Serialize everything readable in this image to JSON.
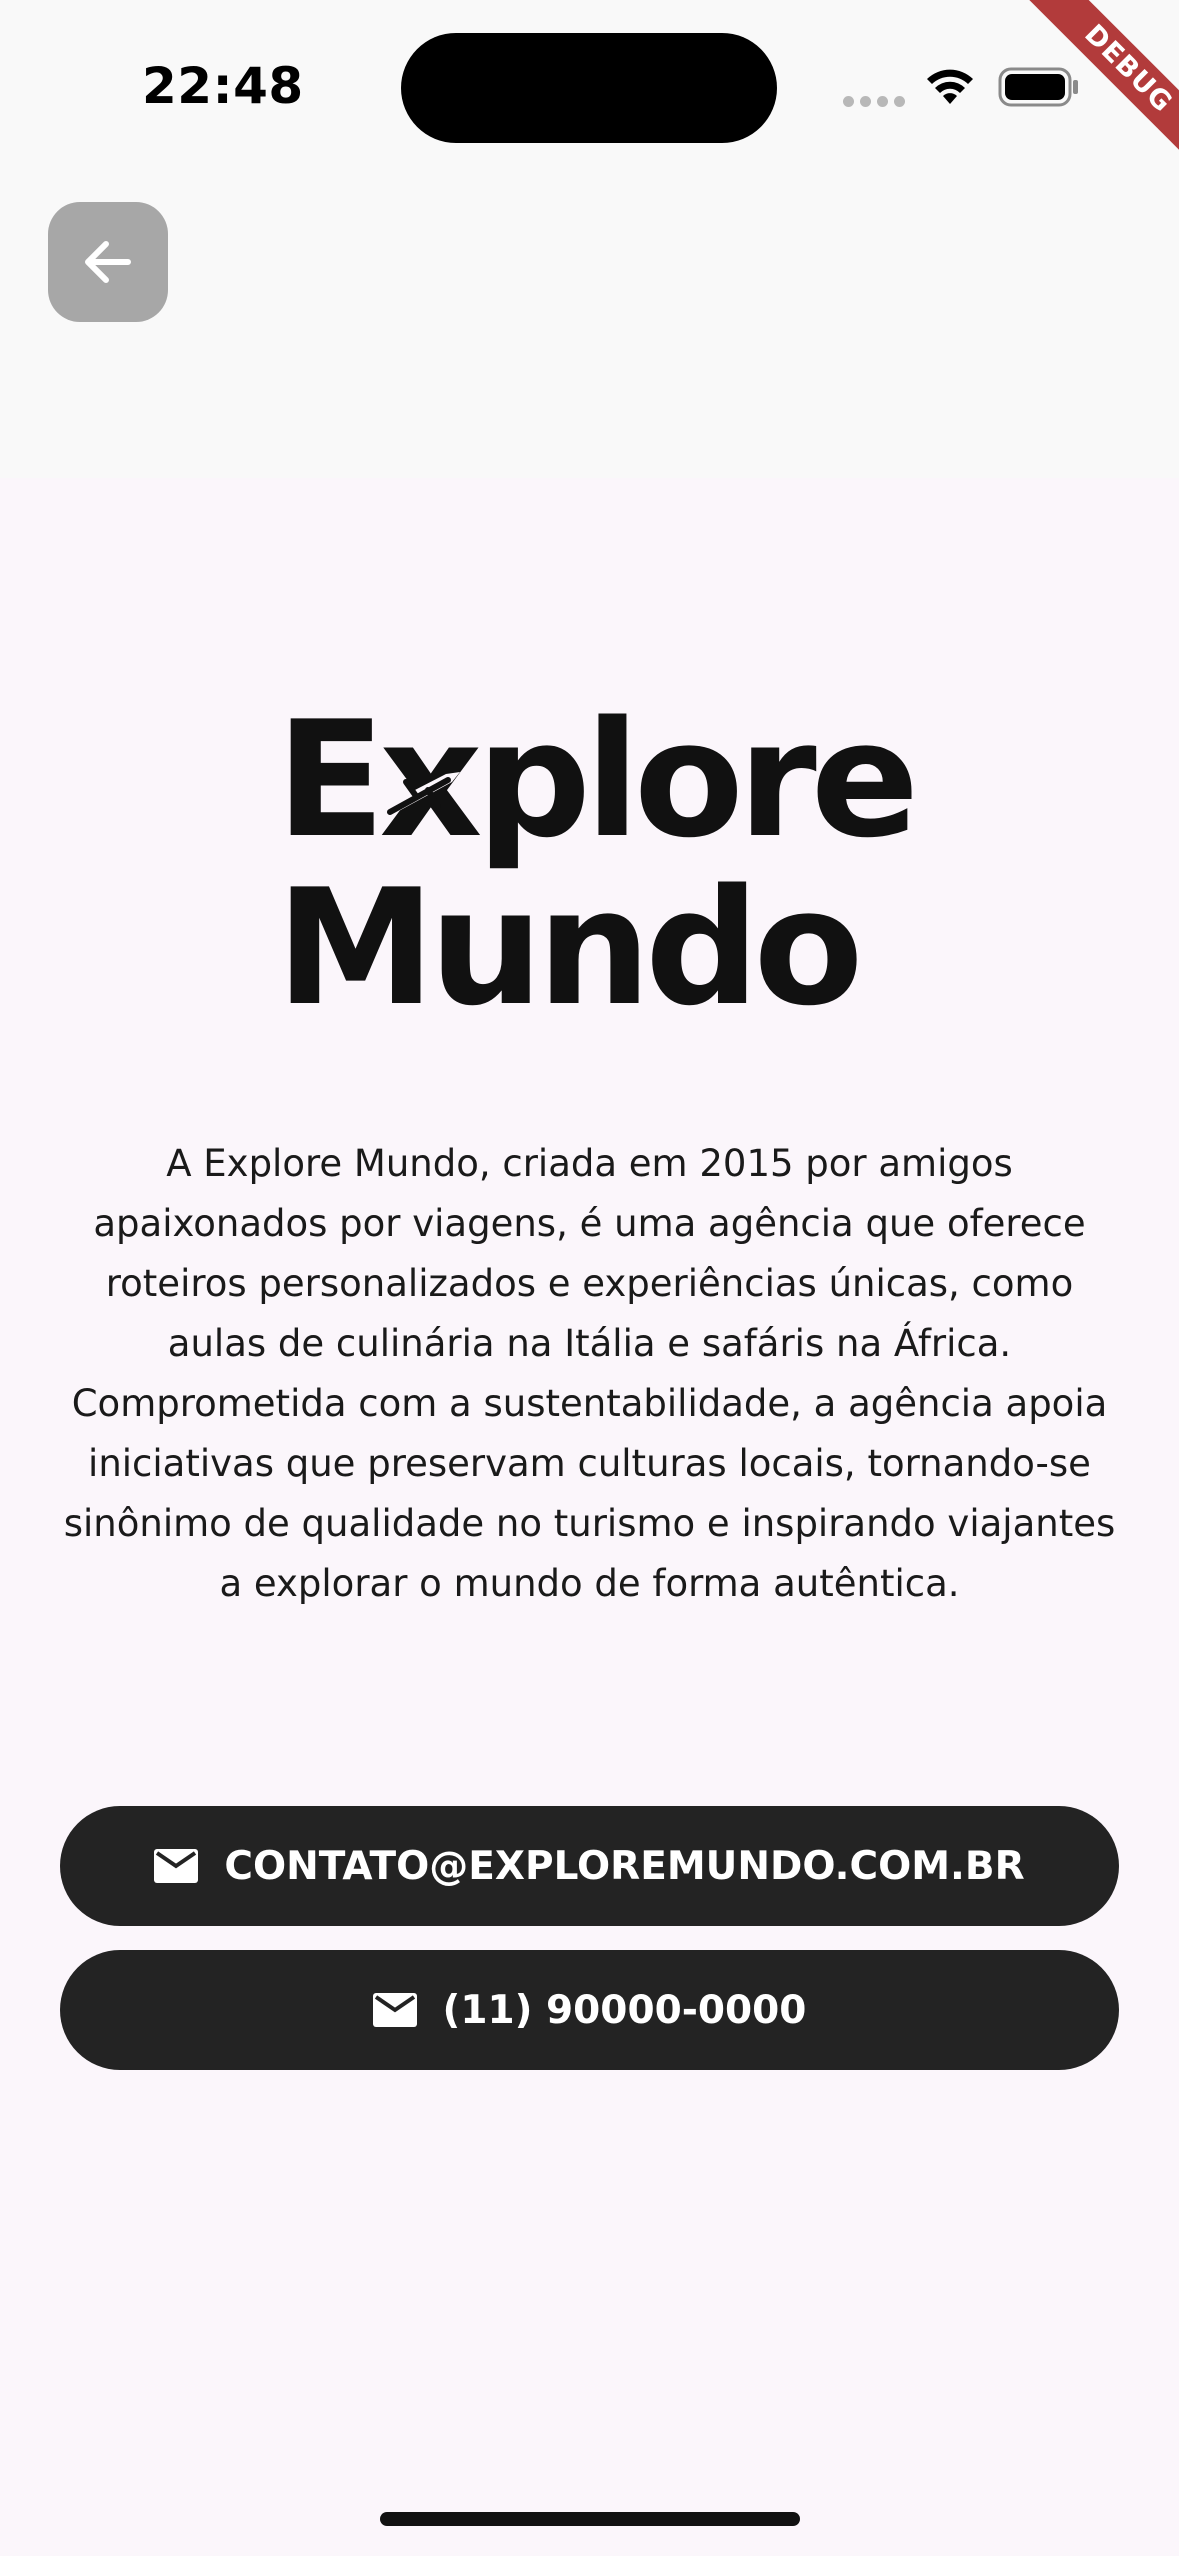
{
  "status_bar": {
    "time": "22:48",
    "debug_label": "DEBUG"
  },
  "nav": {
    "back_icon": "arrow-left-icon"
  },
  "brand": {
    "line1": "Explore",
    "line2": "Mundo",
    "mark_icon": "airplane-icon"
  },
  "about": {
    "text": "A Explore Mundo, criada em 2015 por amigos apaixonados por viagens, é uma agência que oferece roteiros personalizados e experiências únicas, como aulas de culinária na Itália e safáris na África. Comprometida com a sustentabilidade, a agência apoia iniciativas que preservam culturas locais, tornando-se sinônimo de qualidade no turismo e inspirando viajantes a explorar o mundo de forma autêntica."
  },
  "contacts": {
    "email_label": "CONTATO@EXPLOREMUNDO.COM.BR",
    "email_icon": "mail-icon",
    "phone_label": "(11) 90000-0000",
    "phone_icon": "mail-icon"
  },
  "colors": {
    "background": "#fbf6fb",
    "button": "#232323",
    "back_button": "#a7a7a7",
    "debug": "#b23b3b"
  }
}
